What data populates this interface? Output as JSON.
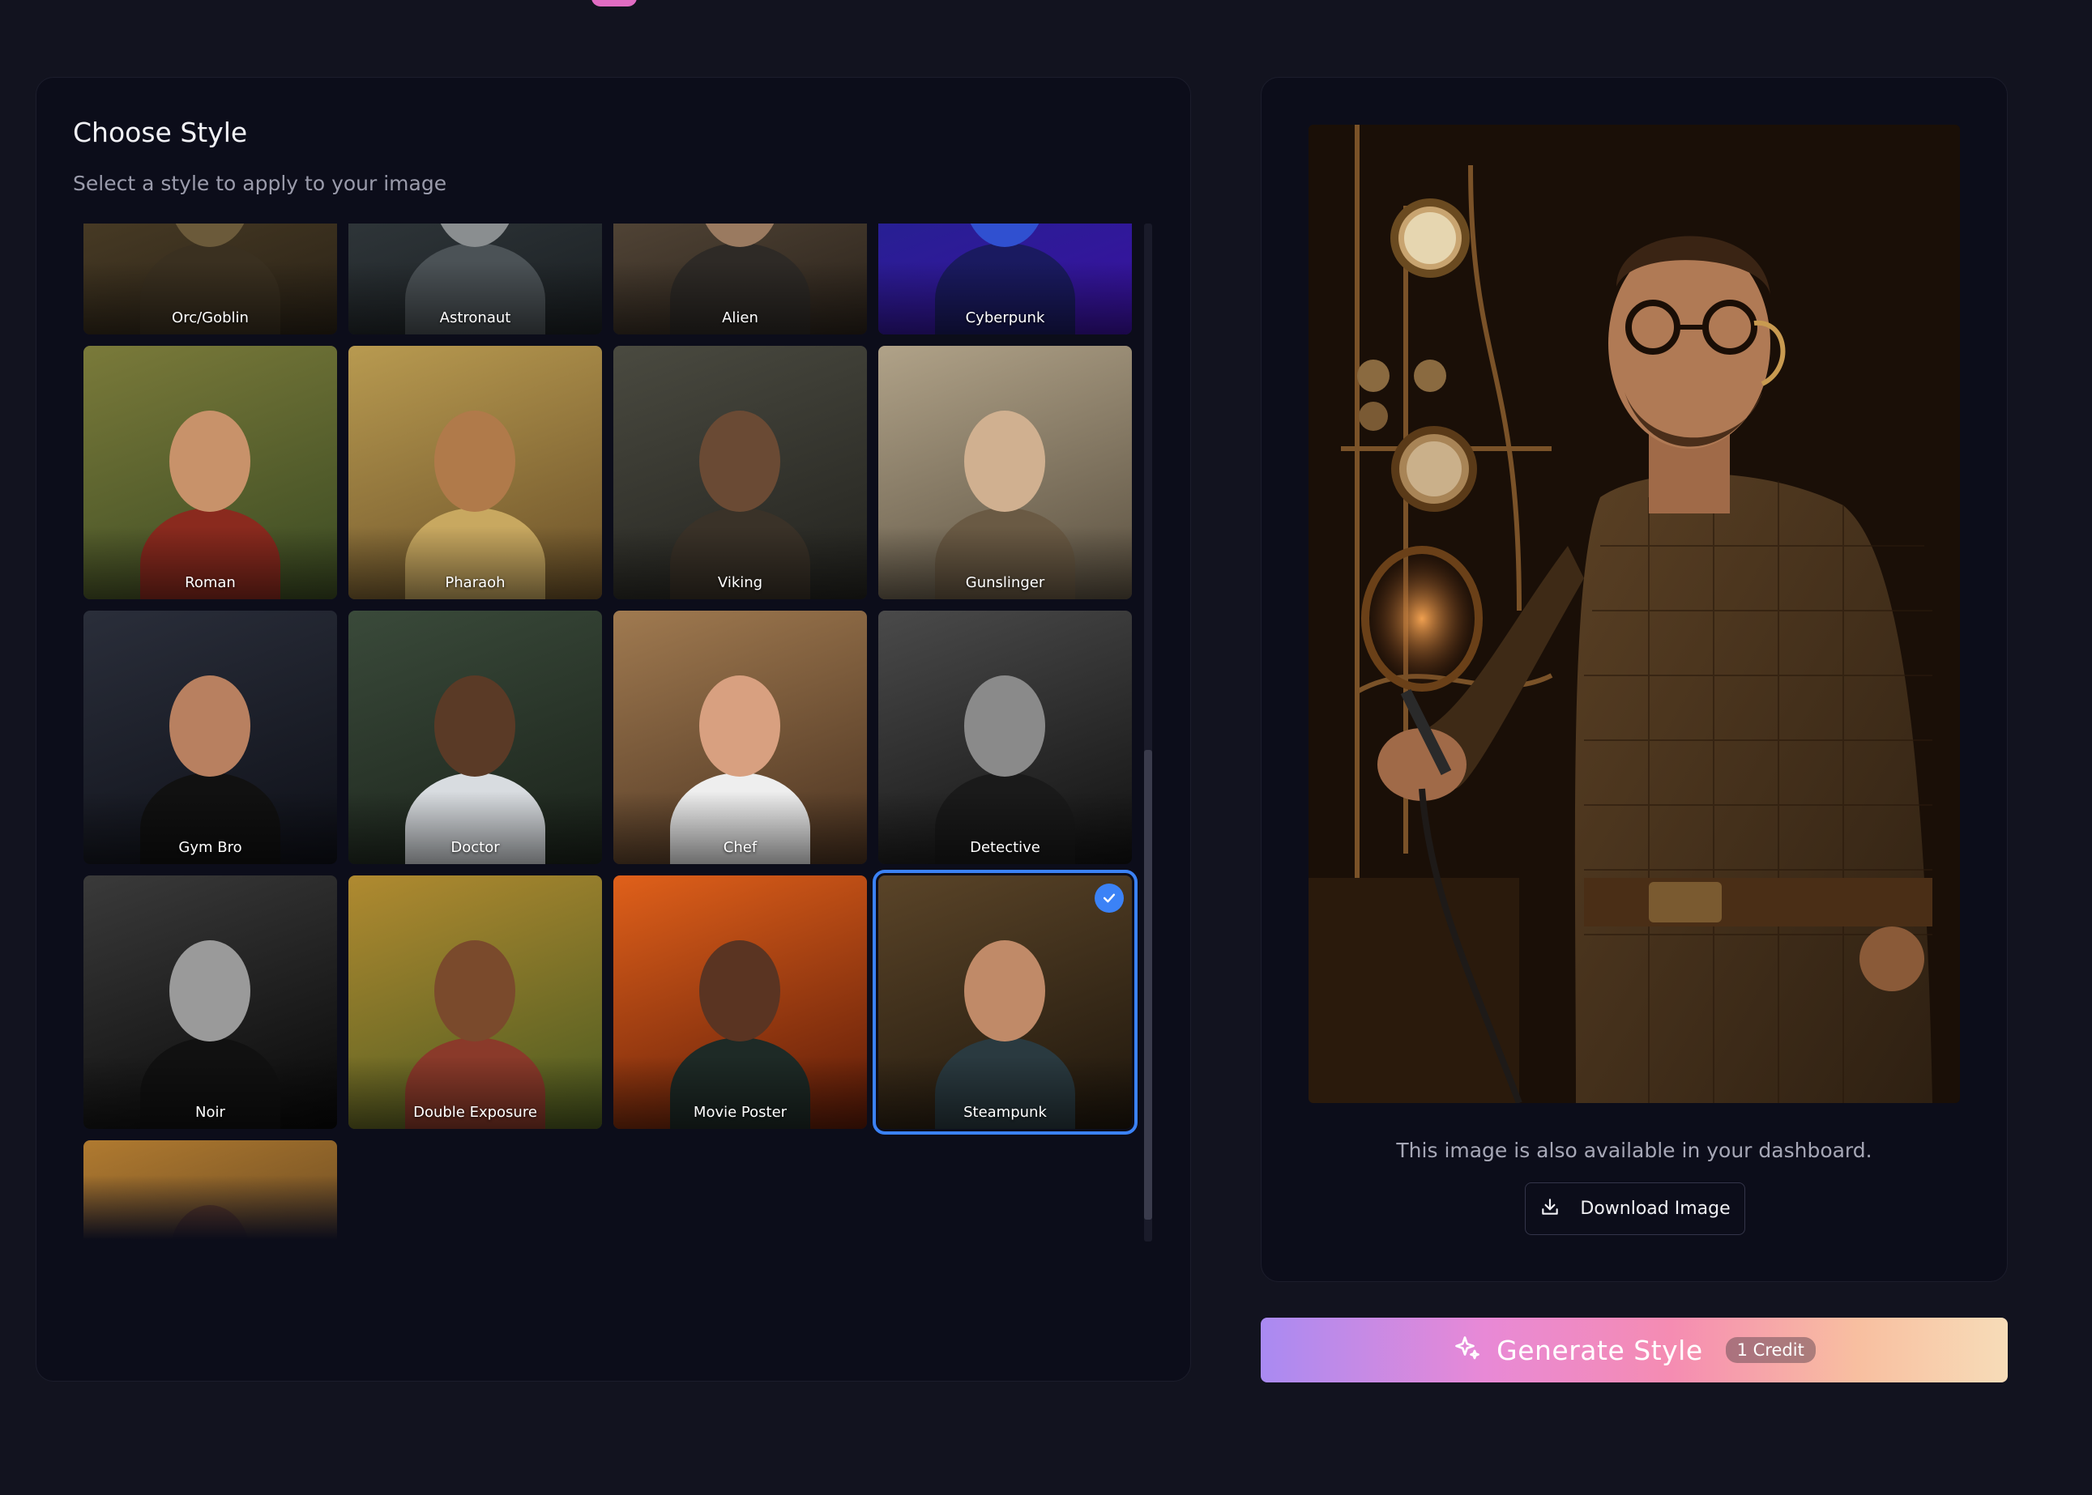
{
  "style_panel": {
    "title": "Choose Style",
    "subtitle": "Select a style to apply to your image",
    "styles": [
      {
        "label": "Orc/Goblin",
        "bg": [
          "#5a4a2e",
          "#2a2216"
        ],
        "skin": "#6b5a3a",
        "cloth": "#3a3020"
      },
      {
        "label": "Astronaut",
        "bg": [
          "#3c4448",
          "#1a1f22"
        ],
        "skin": "#8a8e90",
        "cloth": "#4b5256"
      },
      {
        "label": "Alien",
        "bg": [
          "#6a5a48",
          "#2a221a"
        ],
        "skin": "#9a7a60",
        "cloth": "#2e2a26"
      },
      {
        "label": "Cyberpunk",
        "bg": [
          "#1a2a8a",
          "#3a10a0"
        ],
        "skin": "#3050d0",
        "cloth": "#1a1a60"
      },
      {
        "label": "Roman",
        "bg": [
          "#7a7a3a",
          "#3a4a22"
        ],
        "skin": "#c8926a",
        "cloth": "#8a2a1e"
      },
      {
        "label": "Pharaoh",
        "bg": [
          "#b89a50",
          "#6a5028"
        ],
        "skin": "#b07a4a",
        "cloth": "#c8a860"
      },
      {
        "label": "Viking",
        "bg": [
          "#4a4a40",
          "#22221e"
        ],
        "skin": "#6a4a34",
        "cloth": "#3a3228"
      },
      {
        "label": "Gunslinger",
        "bg": [
          "#b0a288",
          "#5a5040"
        ],
        "skin": "#d0b090",
        "cloth": "#6a5a44"
      },
      {
        "label": "Gym Bro",
        "bg": [
          "#2a2e3a",
          "#0e1018"
        ],
        "skin": "#b88060",
        "cloth": "#111111"
      },
      {
        "label": "Doctor",
        "bg": [
          "#3a4a3a",
          "#1a221a"
        ],
        "skin": "#5a3a26",
        "cloth": "#d8dce0"
      },
      {
        "label": "Chef",
        "bg": [
          "#a07a50",
          "#4a3220"
        ],
        "skin": "#d8a080",
        "cloth": "#eeeeee"
      },
      {
        "label": "Detective",
        "bg": [
          "#4a4a4a",
          "#111111"
        ],
        "skin": "#8a8a8a",
        "cloth": "#1a1a1a"
      },
      {
        "label": "Noir",
        "bg": [
          "#3a3a3a",
          "#080808"
        ],
        "skin": "#9a9a9a",
        "cloth": "#111111"
      },
      {
        "label": "Double Exposure",
        "bg": [
          "#b08a30",
          "#4a5a20"
        ],
        "skin": "#7a4a2c",
        "cloth": "#8a3a2a"
      },
      {
        "label": "Movie Poster",
        "bg": [
          "#e0601a",
          "#5a1a08"
        ],
        "skin": "#5a3422",
        "cloth": "#1e2a26"
      },
      {
        "label": "Steampunk",
        "bg": [
          "#5a4428",
          "#1e160c"
        ],
        "skin": "#c08a68",
        "cloth": "#2a3a40",
        "selected": true
      },
      {
        "label": "",
        "bg": [
          "#b07a30",
          "#3a2a18"
        ],
        "skin": "#6a4028",
        "cloth": "#4a2a18"
      }
    ]
  },
  "preview": {
    "note": "This image is also available in your dashboard.",
    "download_label": "Download Image"
  },
  "generate": {
    "label": "Generate Style",
    "credit": "1 Credit"
  },
  "colors": {
    "accent": "#3b82f6",
    "panel_bg": "#0c0d1a",
    "page_bg": "#12131f"
  },
  "icons": {
    "download": "download-icon",
    "sparkle": "sparkle-icon",
    "check": "check-icon"
  }
}
